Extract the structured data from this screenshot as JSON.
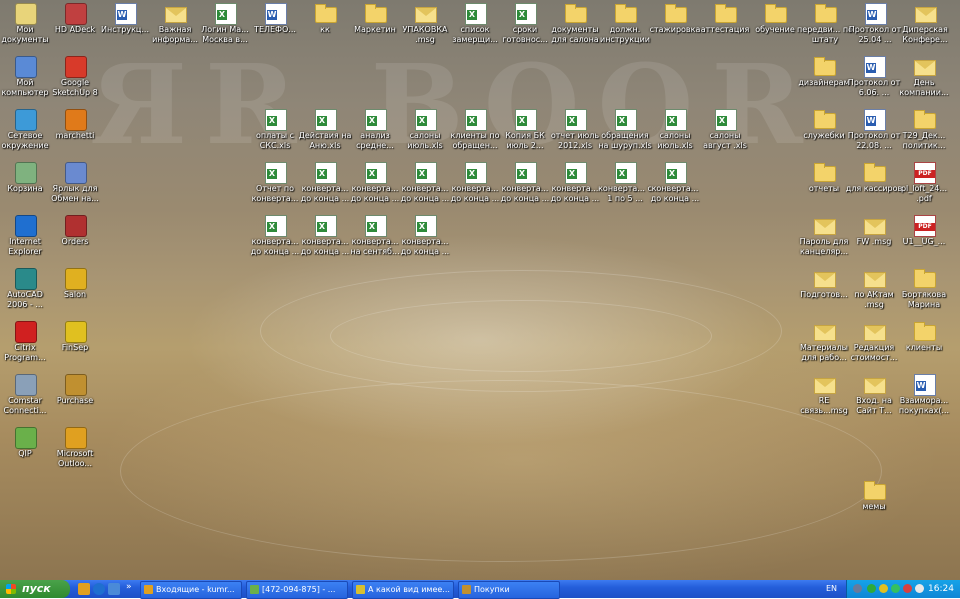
{
  "desktop": {
    "left_column": [
      {
        "label": "Мои документы",
        "icon": "my-documents-icon",
        "color": "#e8d47a"
      },
      {
        "label": "Мой компьютер",
        "icon": "my-computer-icon",
        "color": "#5a8ad6"
      },
      {
        "label": "Сетевое окружение",
        "icon": "network-icon",
        "color": "#3d9ad8"
      },
      {
        "label": "Корзина",
        "icon": "recycle-bin-icon",
        "color": "#7fb27f"
      },
      {
        "label": "Internet Explorer",
        "icon": "ie-icon",
        "color": "#1f6fd0"
      },
      {
        "label": "AutoCAD 2006 - ...",
        "icon": "autocad-icon",
        "color": "#2a8a8a"
      },
      {
        "label": "Citrix Program...",
        "icon": "citrix-icon",
        "color": "#d02020"
      },
      {
        "label": "Comstar Connecti...",
        "icon": "comstar-icon",
        "color": "#8aa0b8"
      },
      {
        "label": "QIP",
        "icon": "qip-icon",
        "color": "#6ab04a"
      }
    ],
    "second_column": [
      {
        "label": "HD ADeck",
        "icon": "hd-adeck-icon",
        "color": "#c04040"
      },
      {
        "label": "Google SketchUp 8",
        "icon": "sketchup-icon",
        "color": "#d83a2a"
      },
      {
        "label": "marchetti",
        "icon": "marchetti-icon",
        "color": "#e07a1a"
      },
      {
        "label": "Ярлык для Обмен на...",
        "icon": "shortcut-exchange-icon",
        "color": "#6a8ad0"
      },
      {
        "label": "Orders",
        "icon": "orders-icon",
        "color": "#b03030"
      },
      {
        "label": "Salon",
        "icon": "salon-icon",
        "color": "#e0b020"
      },
      {
        "label": "FinSep",
        "icon": "finsep-icon",
        "color": "#e0c020"
      },
      {
        "label": "Purchase",
        "icon": "purchase-icon",
        "color": "#c09030"
      },
      {
        "label": "Microsoft Outloo...",
        "icon": "outlook-icon",
        "color": "#e0a020"
      }
    ],
    "top_row": [
      {
        "label": "Инструкц...",
        "type": "doc"
      },
      {
        "label": "Важная информа...",
        "type": "env"
      },
      {
        "label": "Логин Ма... Москва в...",
        "type": "xls"
      },
      {
        "label": "ТЕЛЕФО...",
        "type": "doc"
      },
      {
        "label": "кк",
        "type": "folder"
      },
      {
        "label": "Маркетин",
        "type": "folder"
      },
      {
        "label": "УПАКОВКА .msg",
        "type": "env"
      },
      {
        "label": "список замерщи...",
        "type": "xls"
      },
      {
        "label": "сроки готовнос...",
        "type": "xls"
      },
      {
        "label": "документы для салона",
        "type": "folder"
      },
      {
        "label": "должн. инструкции",
        "type": "folder"
      },
      {
        "label": "стажировка",
        "type": "folder"
      },
      {
        "label": "аттестация",
        "type": "folder"
      },
      {
        "label": "обучение",
        "type": "folder"
      },
      {
        "label": "передви... по штату",
        "type": "folder"
      },
      {
        "label": "Протокол от 25.04 ...",
        "type": "doc"
      },
      {
        "label": "Диперская Конфере...",
        "type": "env"
      }
    ],
    "mid_row_1": [
      {
        "label": "оплаты с СКС.xls",
        "type": "xls"
      },
      {
        "label": "Действия на Аню.xls",
        "type": "xls"
      },
      {
        "label": "анализ средне...",
        "type": "xls"
      },
      {
        "label": "салоны июль.xls",
        "type": "xls"
      },
      {
        "label": "клиенты по обращен...",
        "type": "xls"
      },
      {
        "label": "Копия БК июль 2...",
        "type": "xls"
      },
      {
        "label": "отчет июль 2012.xls",
        "type": "xls"
      },
      {
        "label": "обращения на шуруп.xls",
        "type": "xls"
      },
      {
        "label": "салоны июль.xls",
        "type": "xls"
      },
      {
        "label": "салоны август .xls",
        "type": "xls"
      }
    ],
    "mid_row_2": [
      {
        "label": "Отчет по конверта...",
        "type": "xls"
      },
      {
        "label": "конверта... до конца ...",
        "type": "xls"
      },
      {
        "label": "конверта... до конца ...",
        "type": "xls"
      },
      {
        "label": "конверта... до конца ...",
        "type": "xls"
      },
      {
        "label": "конверта... до конца ...",
        "type": "xls"
      },
      {
        "label": "конверта... до конца ...",
        "type": "xls"
      },
      {
        "label": "конверта... до конца ...",
        "type": "xls"
      },
      {
        "label": "конверта... с 1 по 5 ...",
        "type": "xls"
      },
      {
        "label": "конверта... до конца ...",
        "type": "xls"
      }
    ],
    "mid_row_3": [
      {
        "label": "конверта... до конца ...",
        "type": "xls"
      },
      {
        "label": "конверта... до конца ...",
        "type": "xls"
      },
      {
        "label": "конверта... на сентяб...",
        "type": "xls"
      },
      {
        "label": "конверта... до конца ...",
        "type": "xls"
      }
    ],
    "right_col_a": [
      {
        "label": "дизайнерам",
        "type": "folder",
        "row": 1
      },
      {
        "label": "служебки",
        "type": "folder",
        "row": 2
      },
      {
        "label": "отчеты",
        "type": "folder",
        "row": 3
      },
      {
        "label": "Пароль для канцеляр...",
        "type": "env",
        "row": 4
      },
      {
        "label": "Подготов...",
        "type": "env",
        "row": 5
      },
      {
        "label": "Материалы для рабо...",
        "type": "env",
        "row": 6
      },
      {
        "label": "RE связь...msg",
        "type": "env",
        "row": 7
      }
    ],
    "right_col_b": [
      {
        "label": "Протокол от 6.06. ...",
        "type": "doc",
        "row": 1
      },
      {
        "label": "Протокол от 22.08. ...",
        "type": "doc",
        "row": 2
      },
      {
        "label": "для кассиров",
        "type": "folder",
        "row": 3
      },
      {
        "label": "FW .msg",
        "type": "env",
        "row": 4
      },
      {
        "label": "по АКтам .msg",
        "type": "env",
        "row": 5
      },
      {
        "label": "Редакция стоимост...",
        "type": "env",
        "row": 6
      },
      {
        "label": "Вход. на Сайт Т...",
        "type": "env",
        "row": 7
      },
      {
        "label": "мемы",
        "type": "folder",
        "row": 9
      }
    ],
    "right_col_c": [
      {
        "label": "День компании...",
        "type": "env",
        "row": 1
      },
      {
        "label": "Т29_Дек... политик...",
        "type": "folder",
        "row": 2
      },
      {
        "label": "pl_loft_24... .pdf",
        "type": "pdf",
        "row": 3
      },
      {
        "label": "U1__UG_...",
        "type": "pdf",
        "row": 4
      },
      {
        "label": "Бортякова Марина",
        "type": "folder",
        "row": 5
      },
      {
        "label": "клиенты",
        "type": "folder",
        "row": 6
      },
      {
        "label": "Взаимора... покупках(...",
        "type": "doc",
        "row": 7
      }
    ]
  },
  "taskbar": {
    "start_label": "пуск",
    "tasks": [
      {
        "label": "Входящие - kumr...",
        "icon": "outlook-task-icon",
        "color": "#e0a020"
      },
      {
        "label": "[472-094-875] - ...",
        "icon": "chat-task-icon",
        "color": "#6ab04a"
      },
      {
        "label": "А какой вид имее...",
        "icon": "chrome-task-icon",
        "color": "#d8c030"
      },
      {
        "label": "Покупки",
        "icon": "purchase-task-icon",
        "color": "#c09030"
      }
    ],
    "language": "EN",
    "clock": "16:24"
  }
}
